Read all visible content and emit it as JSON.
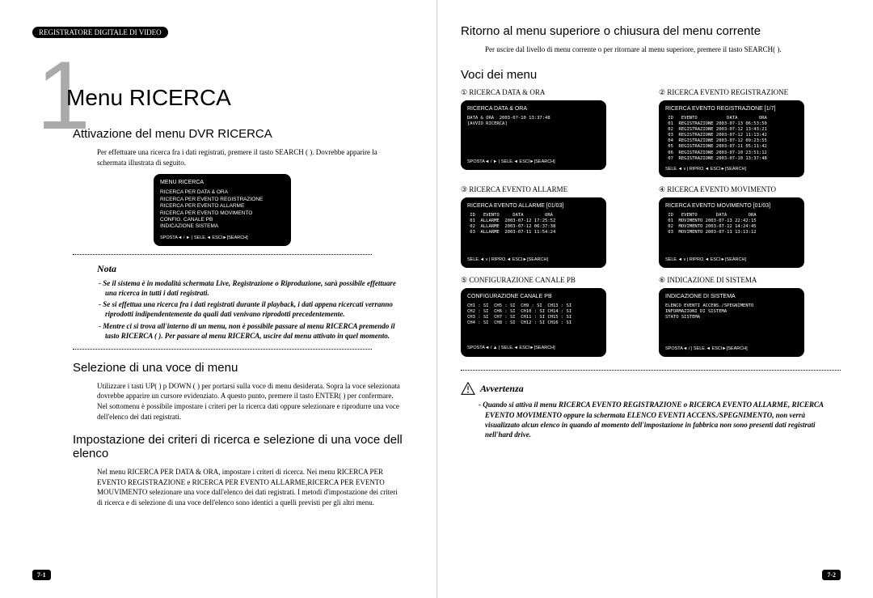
{
  "header_tab": "REGISTRATORE DIGITALE DI VIDEO",
  "chapter_number": "1",
  "h1": "Menu RICERCA",
  "left": {
    "sec1_h": "Attivazione del menu DVR RICERCA",
    "sec1_p": "Per effettuare una ricerca fra i dati registrati, premere il tasto SEARCH (       ). Dovrebbe apparire la schermata illustrata di seguito.",
    "screen_main": {
      "title": "MENU RICERCA",
      "lines": [
        "RICERCA PER DATA & ORA",
        "RICERCA PER EVENTO REGISTRAZIONE",
        "RICERCA PER EVENTO ALLARME",
        "RICERCA PER EVENTO MOVIMENTO",
        "CONFIG. CANALE PB",
        "INDICAZIONE SISTEMA"
      ],
      "footer": "SPOSTA◄ / ► | SELE.◄ ESCI►[SEARCH]"
    },
    "nota_title": "Nota",
    "nota_items": [
      "- Se il sistema è in modalità schermata Live, Registrazione o Riproduzione, sarà possibile effettuare una ricerca in tutti i dati registrati.",
      "- Se si effettua una ricerca fra i dati registrati durante il playback, i dati appena ricercati verranno riprodotti indipendentemente da quali dati venivano riprodotti precedentemente.",
      "- Mentre ci si trova all'interno di un menu, non è possibile passare al menu RICERCA premendo il tasto RICERCA (     ). Per passare al menu RICERCA, uscire dal menu attivato in quel momento."
    ],
    "sec2_h": "Selezione di una voce di menu",
    "sec2_p": "Utilizzare i tasti UP(   ) p DOWN (   ) per portarsi sulla voce di menu desiderata. Sopra la voce selezionata dovrebbe apparire un cursore evidenziato. A questo punto, premere il tasto ENTER(     ) per confermare. Nel sottomenu è possibile impostare i criteri per la ricerca dati oppure selezionare e riprodurre una voce dell'elenco dei dati registrati.",
    "sec3_h": "Impostazione dei criteri di ricerca e selezione di una voce dell elenco",
    "sec3_p": "Nel menu RICERCA PER DATA & ORA, impostare i criteri di ricerca. Nei menu RICERCA PER EVENTO REGISTRAZIONE e RICERCA PER EVENTO ALLARME,RICERCA PER EVENTO MOUVIMENTO selezionare una voce dall'elenco dei dati registrati. I metodi d'impostazione dei criteri di ricerca e di selezione di una voce dell'elenco sono identici a quelli previsti per gli altri menu."
  },
  "right": {
    "sec1_h": "Ritorno al menu superiore o chiusura del menu corrente",
    "sec1_p": "Per uscire dal livello di menu corrente o per ritornare al menu superiore, premere il tasto SEARCH(      ).",
    "sec2_h": "Voci dei menu",
    "cells": [
      {
        "num": "①",
        "label": "RICERCA DATA & ORA",
        "title": "RICERCA DATA & ORA",
        "rows": [
          "DATA & ORA  2003-07-10 13:37:48",
          "[AVVIO RICERCA]"
        ],
        "footer": "SPOSTA◄ / ► | SELE.◄ ESCI►[SEARCH]"
      },
      {
        "num": "②",
        "label": "RICERCA EVENTO REGISTRAZIONE",
        "title": "RICERCA EVENTO REGISTRAZIONE   [1/7]",
        "rows": [
          " ID   EVENTO           DATA        ORA",
          " 01  REGISTRAZIONE 2003-07-13 06:53:50",
          " 02  REGISTRAZIONE 2003-07-12 13:43:21",
          " 03  REGISTRAZIONE 2003-07-12 11:13:42",
          " 04  REGISTRAZIONE 2003-07-12 09:23:55",
          " 05  REGISTRAZIONE 2003-07-11 05:11:42",
          " 06  REGISTRAZIONE 2003-07-10 23:51:12",
          " 07  REGISTRAZIONE 2003-07-10 13:37:48"
        ],
        "footer": "SELE.◄  v  | RIPRO.◄ ESCI►[SEARCH]"
      },
      {
        "num": "③",
        "label": "RICERCA EVENTO ALLARME",
        "title": "RICERCA EVENTO ALLARME      [01/03]",
        "rows": [
          " ID   EVENTO     DATA        ORA",
          " 01  ALLARME  2003-07-12 17:25:52",
          " 02  ALLARME  2003-07-12 06:37:38",
          " 03  ALLARME  2003-07-11 11:54:24"
        ],
        "footer": "SELE.◄  v  | RIPRO.◄ ESCI►[SEARCH]"
      },
      {
        "num": "④",
        "label": "RICERCA EVENTO MOVIMENTO",
        "title": "RICERCA EVENTO MOVIMENTO    [01/03]",
        "rows": [
          " ID   EVENTO       DATA        ORA",
          " 01  MOVIMENTO 2003-07-13 22:42:15",
          " 02  MOVIMENTO 2003-07-12 14:24:45",
          " 03  MOVIMENTO 2003-07-11 13:13:12"
        ],
        "footer": "SELE.◄  v  | RIPRO.◄ ESCI►[SEARCH]"
      },
      {
        "num": "⑤",
        "label": "CONFIGURAZIONE CANALE PB",
        "title": "CONFIGURAZIONE CANALE PB",
        "rows": [
          "CH1 : SI  CH5 : SI  CH9 : SI  CH13 : SI",
          "CH2 : SI  CH6 : SI  CH10 : SI CH14 : SI",
          "CH3 : SI  CH7 : SI  CH11 : SI CH15 : SI",
          "CH4 : SI  CH8 : SI  CH12 : SI CH16 : SI"
        ],
        "footer": "SPOSTA◄ / ▲ | SELE.◄ ESCI►[SEARCH]"
      },
      {
        "num": "⑥",
        "label": "INDICAZIONE DI SISTEMA",
        "title": "INDICAZIONE DI SISTEMA",
        "rows": [
          "ELENCO EVENTI ACCENS./SPEGNIMENTO",
          "INFORMAZIONI DI SISTEMA",
          "STATO SISTEMA"
        ],
        "footer": "SPOSTA◄ / | SELE.◄ ESCI►[SEARCH]"
      }
    ],
    "warn_title": "Avvertenza",
    "warn_text": "- Quando si attiva il menu RICERCA EVENTO REGISTRAZIONE o RICERCA EVENTO ALLARME, RICERCA EVENTO MOVIMENTO oppure la schermata ELENCO EVENTI ACCENS./SPEGNIMENTO, non verrà visualizzato alcun elenco in quando al momento dell'impostazione in fabbrica non sono presenti dati registrati nell'hard drive."
  },
  "page_left": "7-1",
  "page_right": "7-2"
}
